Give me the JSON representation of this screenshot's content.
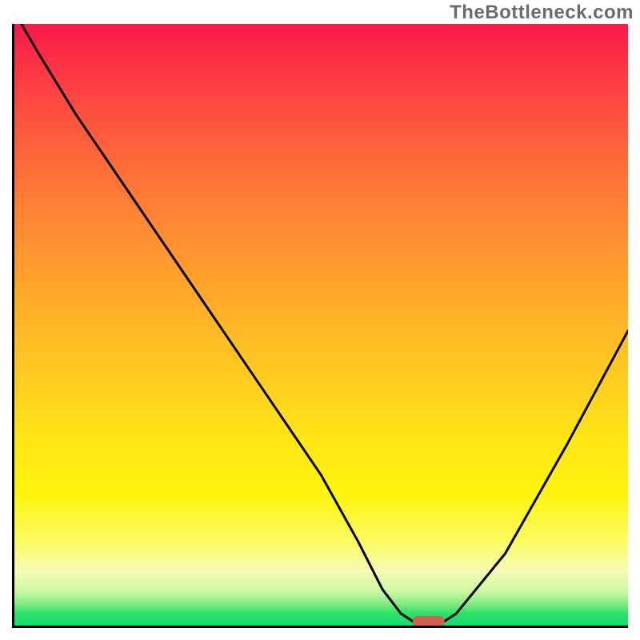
{
  "watermark": "TheBottleneck.com",
  "chart_data": {
    "type": "line",
    "title": "",
    "xlabel": "",
    "ylabel": "",
    "xlim": [
      0,
      100
    ],
    "ylim": [
      0,
      100
    ],
    "grid": false,
    "x": [
      0,
      4,
      10,
      18,
      20,
      30,
      40,
      50,
      56,
      60,
      63,
      66,
      69,
      72,
      80,
      90,
      100
    ],
    "values": [
      102,
      95,
      85,
      73,
      70,
      55,
      40,
      25,
      14,
      6,
      2,
      0,
      0,
      2,
      12,
      30,
      49
    ],
    "notes": "Bottleneck-style curve: steep descent from left, flat zero near x≈65–70, then rises to the right. Background is a red→green vertical heat gradient.",
    "marker": {
      "x": 67.5,
      "y": 0,
      "shape": "pill",
      "color": "#d0604f"
    },
    "gradient_colors": {
      "top": "#fa1749",
      "mid_upper": "#ffa12d",
      "mid": "#fff40c",
      "mid_lower": "#c7f8a1",
      "bottom": "#17db6b"
    }
  }
}
